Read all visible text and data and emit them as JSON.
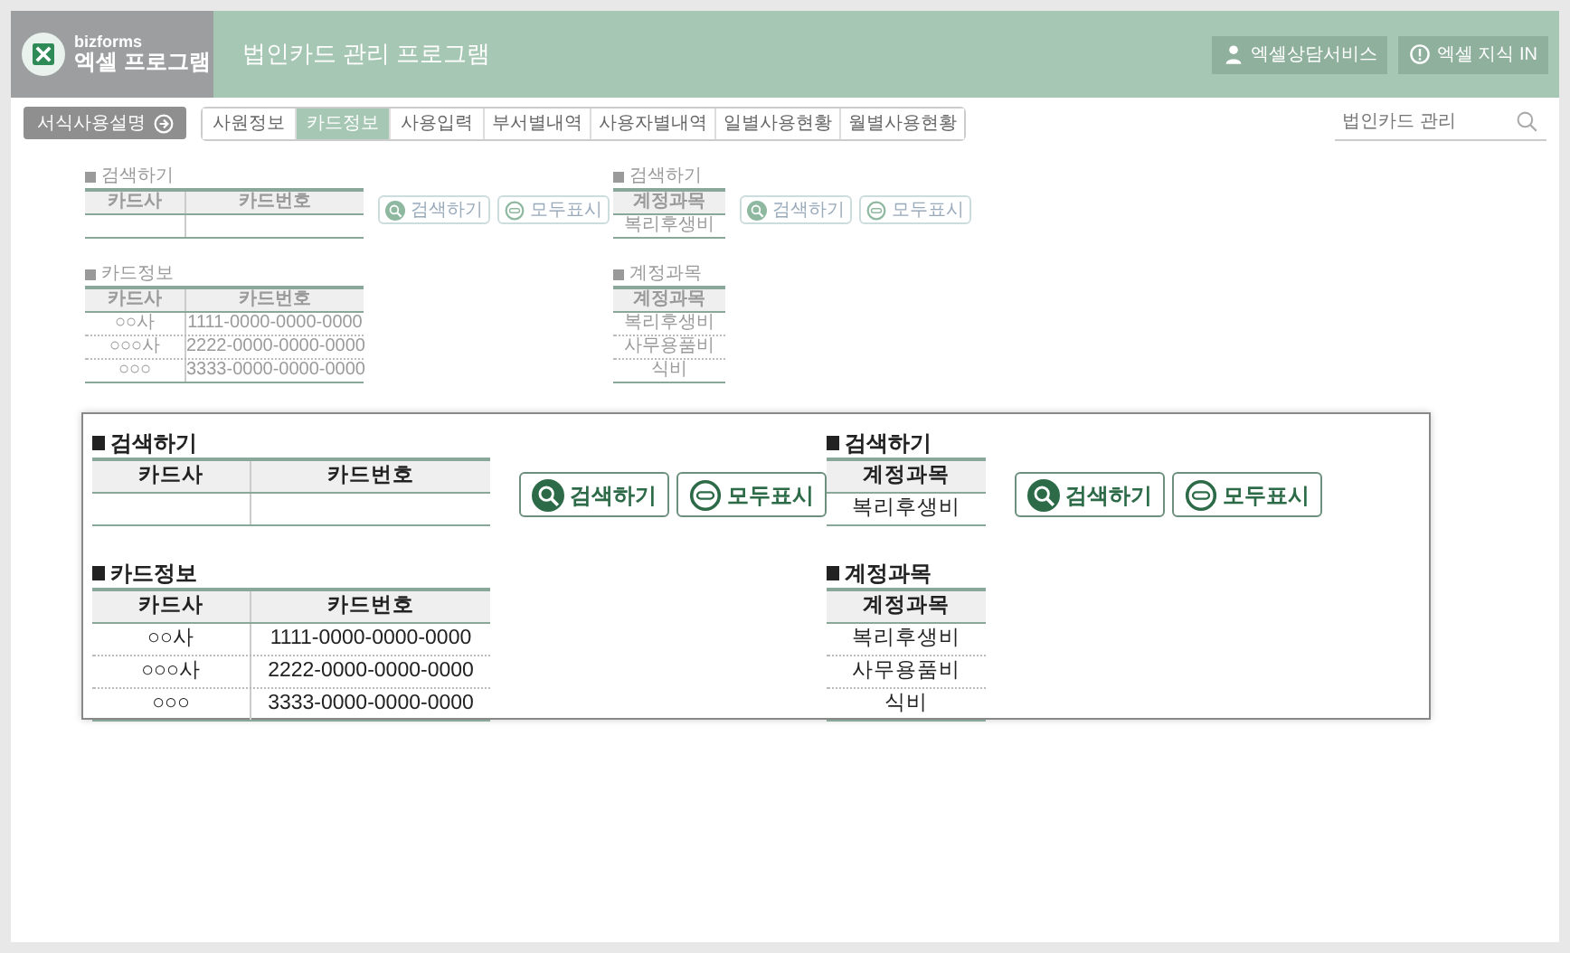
{
  "header": {
    "brand": "bizforms",
    "product": "엑셀 프로그램",
    "title": "법인카드 관리 프로그램",
    "actions": [
      {
        "kind": "person",
        "label": "엑셀상담서비스"
      },
      {
        "kind": "info",
        "label": "엑셀 지식 IN"
      }
    ]
  },
  "guide_button": "서식사용설명",
  "tabs": [
    {
      "label": "사원정보",
      "selected": false
    },
    {
      "label": "카드정보",
      "selected": true
    },
    {
      "label": "사용입력",
      "selected": false
    },
    {
      "label": "부서별내역",
      "selected": false
    },
    {
      "label": "사용자별내역",
      "selected": false
    },
    {
      "label": "일별사용현황",
      "selected": false
    },
    {
      "label": "월별사용현황",
      "selected": false
    }
  ],
  "search": {
    "placeholder": "법인카드 관리"
  },
  "sheet": [
    {
      "search_title": "검색하기",
      "search_columns": [
        "카드사",
        "카드번호"
      ],
      "buttons": [
        {
          "kind": "search",
          "label": "검색하기"
        },
        {
          "kind": "all",
          "label": "모두표시"
        }
      ],
      "list_title": "카드정보",
      "list_columns": [
        "카드사",
        "카드번호"
      ],
      "list_rows": [
        [
          "○○사",
          "1111-0000-0000-0000"
        ],
        [
          "○○○사",
          "2222-0000-0000-0000"
        ],
        [
          "○○○",
          "3333-0000-0000-0000"
        ]
      ]
    },
    {
      "search_title": "검색하기",
      "search_columns": [
        "계정과목"
      ],
      "input_row": [
        "복리후생비"
      ],
      "buttons": [
        {
          "kind": "search",
          "label": "검색하기"
        },
        {
          "kind": "all",
          "label": "모두표시"
        }
      ],
      "list_title": "계정과목",
      "list_columns": [
        "계정과목"
      ],
      "list_rows": [
        [
          "복리후생비"
        ],
        [
          "사무용품비"
        ],
        [
          "식비"
        ]
      ]
    }
  ],
  "callout": [
    {
      "search_title": "검색하기",
      "search_columns": [
        "카드사",
        "카드번호"
      ],
      "buttons": [
        {
          "kind": "search",
          "label": "검색하기"
        },
        {
          "kind": "all",
          "label": "모두표시"
        }
      ],
      "list_title": "카드정보",
      "list_columns": [
        "카드사",
        "카드번호"
      ],
      "list_rows": [
        [
          "○○사",
          "1111-0000-0000-0000"
        ],
        [
          "○○○사",
          "2222-0000-0000-0000"
        ],
        [
          "○○○",
          "3333-0000-0000-0000"
        ]
      ]
    },
    {
      "search_title": "검색하기",
      "search_columns": [
        "계정과목"
      ],
      "input_row": [
        "복리후생비"
      ],
      "buttons": [
        {
          "kind": "search",
          "label": "검색하기"
        },
        {
          "kind": "all",
          "label": "모두표시"
        }
      ],
      "list_title": "계정과목",
      "list_columns": [
        "계정과목"
      ],
      "list_rows": [
        [
          "복리후생비"
        ],
        [
          "사무용품비"
        ],
        [
          "식비"
        ]
      ]
    }
  ]
}
